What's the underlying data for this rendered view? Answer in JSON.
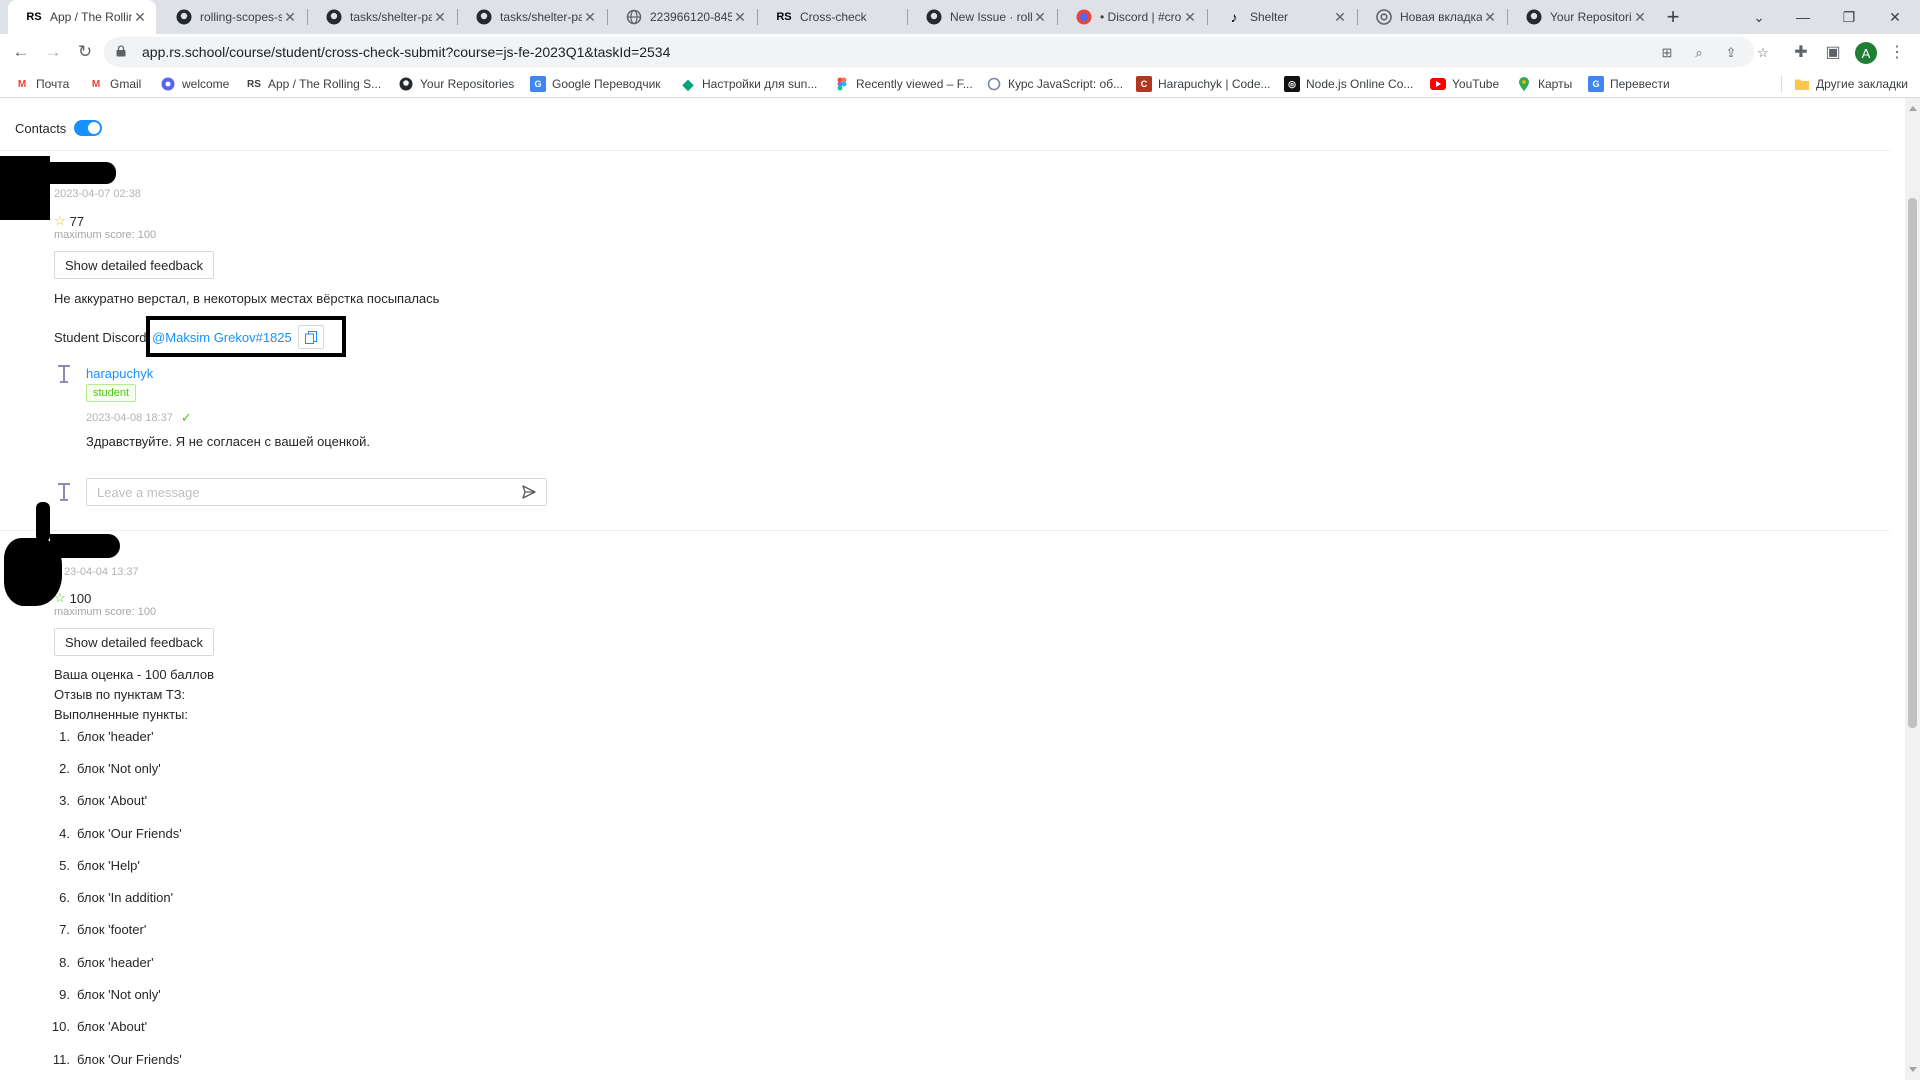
{
  "browser": {
    "tabs": [
      {
        "title": "App / The Rollin",
        "icon": "rs-school-icon",
        "active": true
      },
      {
        "title": "rolling-scopes-s",
        "icon": "github-icon"
      },
      {
        "title": "tasks/shelter-pa",
        "icon": "github-icon"
      },
      {
        "title": "tasks/shelter-pa",
        "icon": "github-icon"
      },
      {
        "title": "223966120-845",
        "icon": "globe-icon"
      },
      {
        "title": "Cross-check",
        "icon": "rs-school-icon"
      },
      {
        "title": "New Issue · rolli",
        "icon": "github-icon"
      },
      {
        "title": "• Discord | #cro",
        "icon": "discord-icon"
      },
      {
        "title": "Shelter",
        "icon": "shelter-icon"
      },
      {
        "title": "Новая вкладка",
        "icon": "chrome-icon"
      },
      {
        "title": "Your Repositorie",
        "icon": "github-icon"
      }
    ],
    "url": "app.rs.school/course/student/cross-check-submit?course=js-fe-2023Q1&taskId=2534",
    "profile_initial": "A",
    "bookmarks": [
      {
        "label": "Почта",
        "icon": "gmail-icon"
      },
      {
        "label": "Gmail",
        "icon": "gmail-icon"
      },
      {
        "label": "welcome",
        "icon": "welcome-icon"
      },
      {
        "label": "App / The Rolling S...",
        "icon": "rs-school-icon"
      },
      {
        "label": "Your Repositories",
        "icon": "github-icon"
      },
      {
        "label": "Google Переводчик",
        "icon": "translate-icon"
      },
      {
        "label": "Настройки для sun...",
        "icon": "diamond-icon"
      },
      {
        "label": "Recently viewed – F...",
        "icon": "figma-icon"
      },
      {
        "label": "Курс JavaScript: об...",
        "icon": "course-icon"
      },
      {
        "label": "Harapuchyk | Code...",
        "icon": "codewars-icon"
      },
      {
        "label": "Node.js Online Co...",
        "icon": "nodejs-icon"
      },
      {
        "label": "YouTube",
        "icon": "youtube-icon"
      },
      {
        "label": "Карты",
        "icon": "maps-icon"
      },
      {
        "label": "Перевести",
        "icon": "translate-icon"
      }
    ],
    "other_bookmarks": "Другие закладки"
  },
  "page": {
    "contacts_label": "Contacts",
    "contacts_enabled": true,
    "reviews": [
      {
        "date": "2023-04-07 02:38",
        "score": "77",
        "max_score": "maximum score: 100",
        "feedback_button": "Show detailed feedback",
        "comment": "Не аккуратно верстал, в некоторых местах вёрстка посыпалась",
        "discord_label": "Student Discord:",
        "discord_handle": "@Maksim Grekov#1825",
        "messages": [
          {
            "author": "harapuchyk",
            "role": "student",
            "date": "2023-04-08 18:37",
            "text": "Здравствуйте. Я не согласен с вашей оценкой."
          }
        ],
        "message_placeholder": "Leave a message"
      },
      {
        "date": "23-04-04 13:37",
        "score": "100",
        "max_score": "maximum score: 100",
        "feedback_button": "Show detailed feedback",
        "lines": [
          "Ваша оценка - 100 баллов",
          "Отзыв по пунктам ТЗ:",
          "Выполненные пункты:"
        ],
        "items": [
          "блок 'header'",
          "блок 'Not only'",
          "блок 'About'",
          "блок 'Our Friends'",
          "блок 'Help'",
          "блок 'In addition'",
          "блок 'footer'",
          "блок 'header'",
          "блок 'Not only'",
          "блок 'About'",
          "блок 'Our Friends'"
        ]
      }
    ]
  }
}
